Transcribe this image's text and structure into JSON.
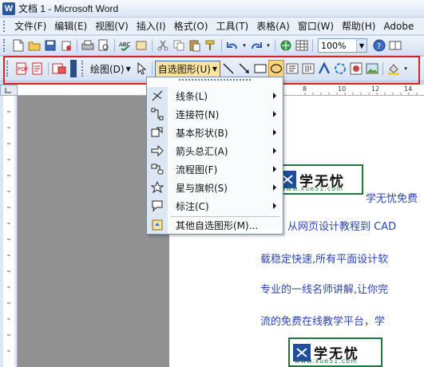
{
  "window": {
    "title": "文档 1 - Microsoft Word"
  },
  "menubar": {
    "items": [
      "文件(F)",
      "编辑(E)",
      "视图(V)",
      "插入(I)",
      "格式(O)",
      "工具(T)",
      "表格(A)",
      "窗口(W)",
      "帮助(H)",
      "Adobe"
    ]
  },
  "standard_toolbar": {
    "zoom": "100%"
  },
  "drawing_toolbar": {
    "draw_label": "绘图(D)",
    "autoshapes_label": "自选图形(U)"
  },
  "ruler": {
    "ticks": [
      "8",
      "10",
      "12",
      "14"
    ]
  },
  "autoshapes_menu": {
    "items": [
      {
        "label": "线条(L)",
        "submenu": true
      },
      {
        "label": "连接符(N)",
        "submenu": true
      },
      {
        "label": "基本形状(B)",
        "submenu": true
      },
      {
        "label": "箭头总汇(A)",
        "submenu": true
      },
      {
        "label": "流程图(F)",
        "submenu": true
      },
      {
        "label": "星与旗帜(S)",
        "submenu": true
      },
      {
        "label": "标注(C)",
        "submenu": true
      },
      {
        "label": "其他自选图形(M)...",
        "submenu": false
      }
    ]
  },
  "document": {
    "logo_text": "学无忧",
    "logo_url": "www.xue51.com",
    "lines": [
      "学无忧免费",
      "，从网页设计教程到 CAD",
      "载稳定快速,所有平面设计软",
      "专业的一线名师讲解,让你完",
      "流的免费在线教学平台，学"
    ]
  },
  "colors": {
    "highlight_box": "#e02020",
    "doc_text": "#2a46b5",
    "logo_border": "#1e7a3a"
  }
}
